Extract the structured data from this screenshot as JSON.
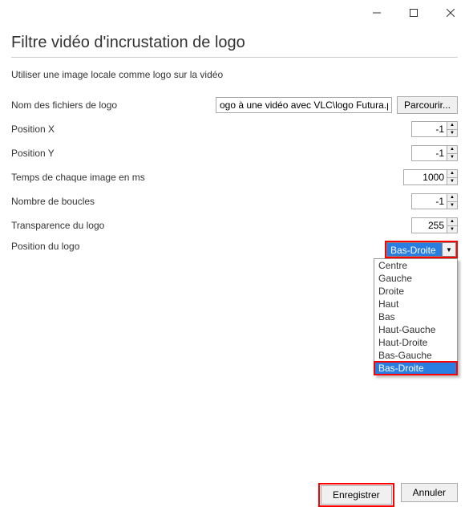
{
  "title": "Filtre vidéo d'incrustation de logo",
  "subtitle": "Utiliser une image locale comme logo sur la vidéo",
  "fields": {
    "filename": {
      "label": "Nom des fichiers de logo",
      "value": "ogo à une vidéo avec VLC\\logo Futura.png",
      "browse": "Parcourir..."
    },
    "posx": {
      "label": "Position X",
      "value": "-1"
    },
    "posy": {
      "label": "Position Y",
      "value": "-1"
    },
    "delay": {
      "label": "Temps de chaque image en ms",
      "value": "1000"
    },
    "loops": {
      "label": "Nombre de boucles",
      "value": "-1"
    },
    "transparency": {
      "label": "Transparence du logo",
      "value": "255"
    },
    "position": {
      "label": "Position du logo",
      "selected": "Bas-Droite",
      "options": [
        "Centre",
        "Gauche",
        "Droite",
        "Haut",
        "Bas",
        "Haut-Gauche",
        "Haut-Droite",
        "Bas-Gauche",
        "Bas-Droite"
      ]
    }
  },
  "buttons": {
    "save": "Enregistrer",
    "cancel": "Annuler"
  }
}
